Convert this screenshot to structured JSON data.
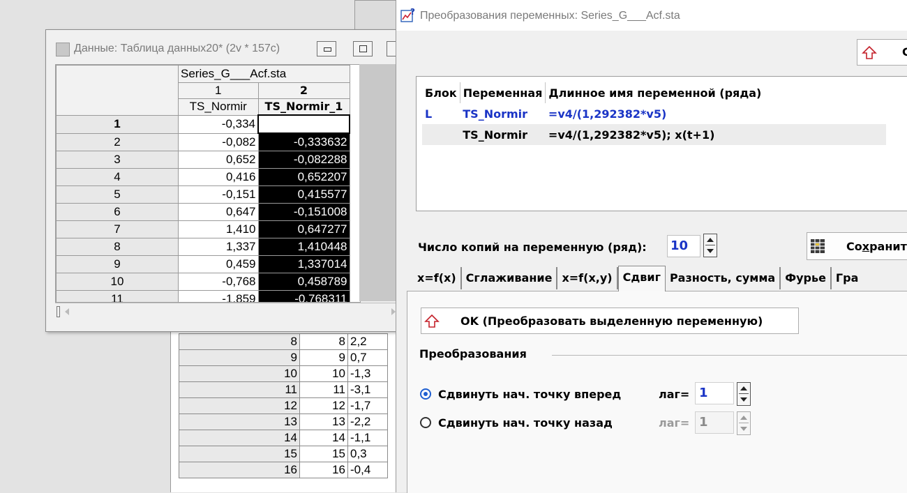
{
  "back_sheet": {
    "rows": [
      {
        "n": "8",
        "a": "8",
        "b": "2,2"
      },
      {
        "n": "9",
        "a": "9",
        "b": "0,7"
      },
      {
        "n": "10",
        "a": "10",
        "b": "-1,3"
      },
      {
        "n": "11",
        "a": "11",
        "b": "-3,1"
      },
      {
        "n": "12",
        "a": "12",
        "b": "-1,7"
      },
      {
        "n": "13",
        "a": "13",
        "b": "-2,2"
      },
      {
        "n": "14",
        "a": "14",
        "b": "-1,1"
      },
      {
        "n": "15",
        "a": "15",
        "b": "0,3"
      },
      {
        "n": "16",
        "a": "16",
        "b": "-0,4"
      }
    ]
  },
  "data_window": {
    "title": "Данные: Таблица данных20* (2v * 157c)",
    "sheet_name": "Series_G___Acf.sta",
    "col1_num": "1",
    "col1_name": "TS_Normir",
    "col2_num": "2",
    "col2_name": "TS_Normir_1",
    "rows": [
      {
        "n": "1",
        "v1": "-0,334",
        "v2": ""
      },
      {
        "n": "2",
        "v1": "-0,082",
        "v2": "-0,333632"
      },
      {
        "n": "3",
        "v1": "0,652",
        "v2": "-0,082288"
      },
      {
        "n": "4",
        "v1": "0,416",
        "v2": "0,652207"
      },
      {
        "n": "5",
        "v1": "-0,151",
        "v2": "0,415577"
      },
      {
        "n": "6",
        "v1": "0,647",
        "v2": "-0,151008"
      },
      {
        "n": "7",
        "v1": "1,410",
        "v2": "0,647277"
      },
      {
        "n": "8",
        "v1": "1,337",
        "v2": "1,410448"
      },
      {
        "n": "9",
        "v1": "0,459",
        "v2": "1,337014"
      },
      {
        "n": "10",
        "v1": "-0,768",
        "v2": "0,458789"
      },
      {
        "n": "11",
        "v1": "-1,859",
        "v2": "-0,768311"
      }
    ]
  },
  "dialog": {
    "title": "Преобразования переменных: Series_G___Acf.sta",
    "top_button_label": "C",
    "list": {
      "headers": [
        "Блок",
        "Переменная",
        "Длинное имя переменной (ряда)"
      ],
      "rows": [
        {
          "block": "L",
          "var": "TS_Normir",
          "long": "=v4/(1,292382*v5)"
        },
        {
          "block": "",
          "var": "TS_Normir",
          "long": "=v4/(1,292382*v5); x(t+1)"
        }
      ]
    },
    "copies_label": "Число копий на переменную (ряд):",
    "copies_value": "10",
    "save_prefix": "Со",
    "save_underline": "х",
    "save_suffix": "ранит",
    "tabs": [
      "x=f(x)",
      "Сглаживание",
      "x=f(x,y)",
      "Сдвиг",
      "Разность, сумма",
      "Фурье",
      "Гра"
    ],
    "ok_label": "OK (Преобразовать выделенную переменную)",
    "group_label": "Преобразования",
    "radio_forward": "Сдвинуть нач. точку вперед",
    "radio_back": "Сдвинуть нач. точку назад",
    "lag_label": "лаг=",
    "lag_forward": "1",
    "lag_back": "1",
    "colors": {
      "accent_blue": "#1a34c6",
      "selection_black": "#000000"
    }
  }
}
